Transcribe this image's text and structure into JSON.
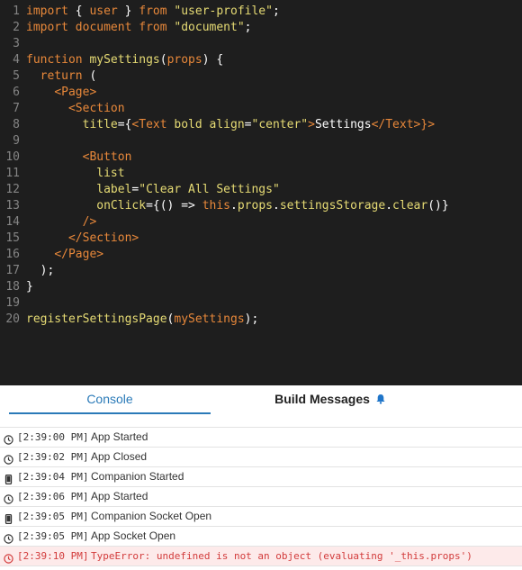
{
  "editor": {
    "lines": [
      {
        "num": "1",
        "tokens": [
          {
            "t": "import",
            "c": "kw"
          },
          {
            "t": " { ",
            "c": "pun"
          },
          {
            "t": "user",
            "c": "kw"
          },
          {
            "t": " } ",
            "c": "pun"
          },
          {
            "t": "from",
            "c": "kw"
          },
          {
            "t": " ",
            "c": "pun"
          },
          {
            "t": "\"user-profile\"",
            "c": "str"
          },
          {
            "t": ";",
            "c": "pun"
          }
        ]
      },
      {
        "num": "2",
        "tokens": [
          {
            "t": "import",
            "c": "kw"
          },
          {
            "t": " ",
            "c": "pun"
          },
          {
            "t": "document",
            "c": "kw"
          },
          {
            "t": " ",
            "c": "pun"
          },
          {
            "t": "from",
            "c": "kw"
          },
          {
            "t": " ",
            "c": "pun"
          },
          {
            "t": "\"document\"",
            "c": "str"
          },
          {
            "t": ";",
            "c": "pun"
          }
        ]
      },
      {
        "num": "3",
        "tokens": []
      },
      {
        "num": "4",
        "tokens": [
          {
            "t": "function",
            "c": "kw"
          },
          {
            "t": " ",
            "c": "pun"
          },
          {
            "t": "mySettings",
            "c": "fn"
          },
          {
            "t": "(",
            "c": "pun"
          },
          {
            "t": "props",
            "c": "kw"
          },
          {
            "t": ") {",
            "c": "pun"
          }
        ]
      },
      {
        "num": "5",
        "tokens": [
          {
            "t": "  ",
            "c": "pun"
          },
          {
            "t": "return",
            "c": "kw"
          },
          {
            "t": " (",
            "c": "pun"
          }
        ]
      },
      {
        "num": "6",
        "tokens": [
          {
            "t": "    ",
            "c": "pun"
          },
          {
            "t": "<Page>",
            "c": "tag"
          }
        ]
      },
      {
        "num": "7",
        "tokens": [
          {
            "t": "      ",
            "c": "pun"
          },
          {
            "t": "<Section",
            "c": "tag"
          }
        ]
      },
      {
        "num": "8",
        "tokens": [
          {
            "t": "        ",
            "c": "pun"
          },
          {
            "t": "title",
            "c": "attr"
          },
          {
            "t": "={",
            "c": "pun"
          },
          {
            "t": "<Text",
            "c": "tag"
          },
          {
            "t": " ",
            "c": "pun"
          },
          {
            "t": "bold",
            "c": "attr"
          },
          {
            "t": " ",
            "c": "pun"
          },
          {
            "t": "align",
            "c": "attr"
          },
          {
            "t": "=",
            "c": "pun"
          },
          {
            "t": "\"center\"",
            "c": "str"
          },
          {
            "t": ">",
            "c": "tag"
          },
          {
            "t": "Settings",
            "c": "id"
          },
          {
            "t": "</Text>",
            "c": "tag"
          },
          {
            "t": "}>",
            "c": "tag"
          }
        ]
      },
      {
        "num": "9",
        "tokens": []
      },
      {
        "num": "10",
        "tokens": [
          {
            "t": "        ",
            "c": "pun"
          },
          {
            "t": "<Button",
            "c": "tag"
          }
        ]
      },
      {
        "num": "11",
        "tokens": [
          {
            "t": "          ",
            "c": "pun"
          },
          {
            "t": "list",
            "c": "attr"
          }
        ]
      },
      {
        "num": "12",
        "tokens": [
          {
            "t": "          ",
            "c": "pun"
          },
          {
            "t": "label",
            "c": "attr"
          },
          {
            "t": "=",
            "c": "pun"
          },
          {
            "t": "\"Clear All Settings\"",
            "c": "str"
          }
        ]
      },
      {
        "num": "13",
        "tokens": [
          {
            "t": "          ",
            "c": "pun"
          },
          {
            "t": "onClick",
            "c": "attr"
          },
          {
            "t": "={() => ",
            "c": "pun"
          },
          {
            "t": "this",
            "c": "kw"
          },
          {
            "t": ".",
            "c": "pun"
          },
          {
            "t": "props",
            "c": "attr"
          },
          {
            "t": ".",
            "c": "pun"
          },
          {
            "t": "settingsStorage",
            "c": "attr"
          },
          {
            "t": ".",
            "c": "pun"
          },
          {
            "t": "clear",
            "c": "attr"
          },
          {
            "t": "()}",
            "c": "pun"
          }
        ]
      },
      {
        "num": "14",
        "tokens": [
          {
            "t": "        ",
            "c": "pun"
          },
          {
            "t": "/>",
            "c": "tag"
          }
        ]
      },
      {
        "num": "15",
        "tokens": [
          {
            "t": "      ",
            "c": "pun"
          },
          {
            "t": "</Section>",
            "c": "tag"
          }
        ]
      },
      {
        "num": "16",
        "tokens": [
          {
            "t": "    ",
            "c": "pun"
          },
          {
            "t": "</Page>",
            "c": "tag"
          }
        ]
      },
      {
        "num": "17",
        "tokens": [
          {
            "t": "  );",
            "c": "pun"
          }
        ]
      },
      {
        "num": "18",
        "tokens": [
          {
            "t": "}",
            "c": "pun"
          }
        ]
      },
      {
        "num": "19",
        "tokens": []
      },
      {
        "num": "20",
        "tokens": [
          {
            "t": "registerSettingsPage",
            "c": "fn"
          },
          {
            "t": "(",
            "c": "pun"
          },
          {
            "t": "mySettings",
            "c": "kw"
          },
          {
            "t": ");",
            "c": "pun"
          }
        ]
      }
    ]
  },
  "tabs": {
    "console_label": "Console",
    "build_label": "Build Messages"
  },
  "console": {
    "rows": [
      {
        "icon": "clock-icon",
        "time": "[2:39:00 PM]",
        "msg": "App Started",
        "error": false
      },
      {
        "icon": "clock-icon",
        "time": "[2:39:02 PM]",
        "msg": "App Closed",
        "error": false
      },
      {
        "icon": "phone-icon",
        "time": "[2:39:04 PM]",
        "msg": "Companion Started",
        "error": false
      },
      {
        "icon": "clock-icon",
        "time": "[2:39:06 PM]",
        "msg": "App Started",
        "error": false
      },
      {
        "icon": "phone-icon",
        "time": "[2:39:05 PM]",
        "msg": "Companion Socket Open",
        "error": false
      },
      {
        "icon": "clock-icon",
        "time": "[2:39:05 PM]",
        "msg": "App Socket Open",
        "error": false
      },
      {
        "icon": "clock-icon",
        "time": "[2:39:10 PM]",
        "msg": "TypeError: undefined is not an object (evaluating '_this.props')",
        "error": true
      }
    ]
  },
  "colors": {
    "accent": "#2a7ab8",
    "error": "#d23b3b",
    "bell": "#1f75c9"
  }
}
